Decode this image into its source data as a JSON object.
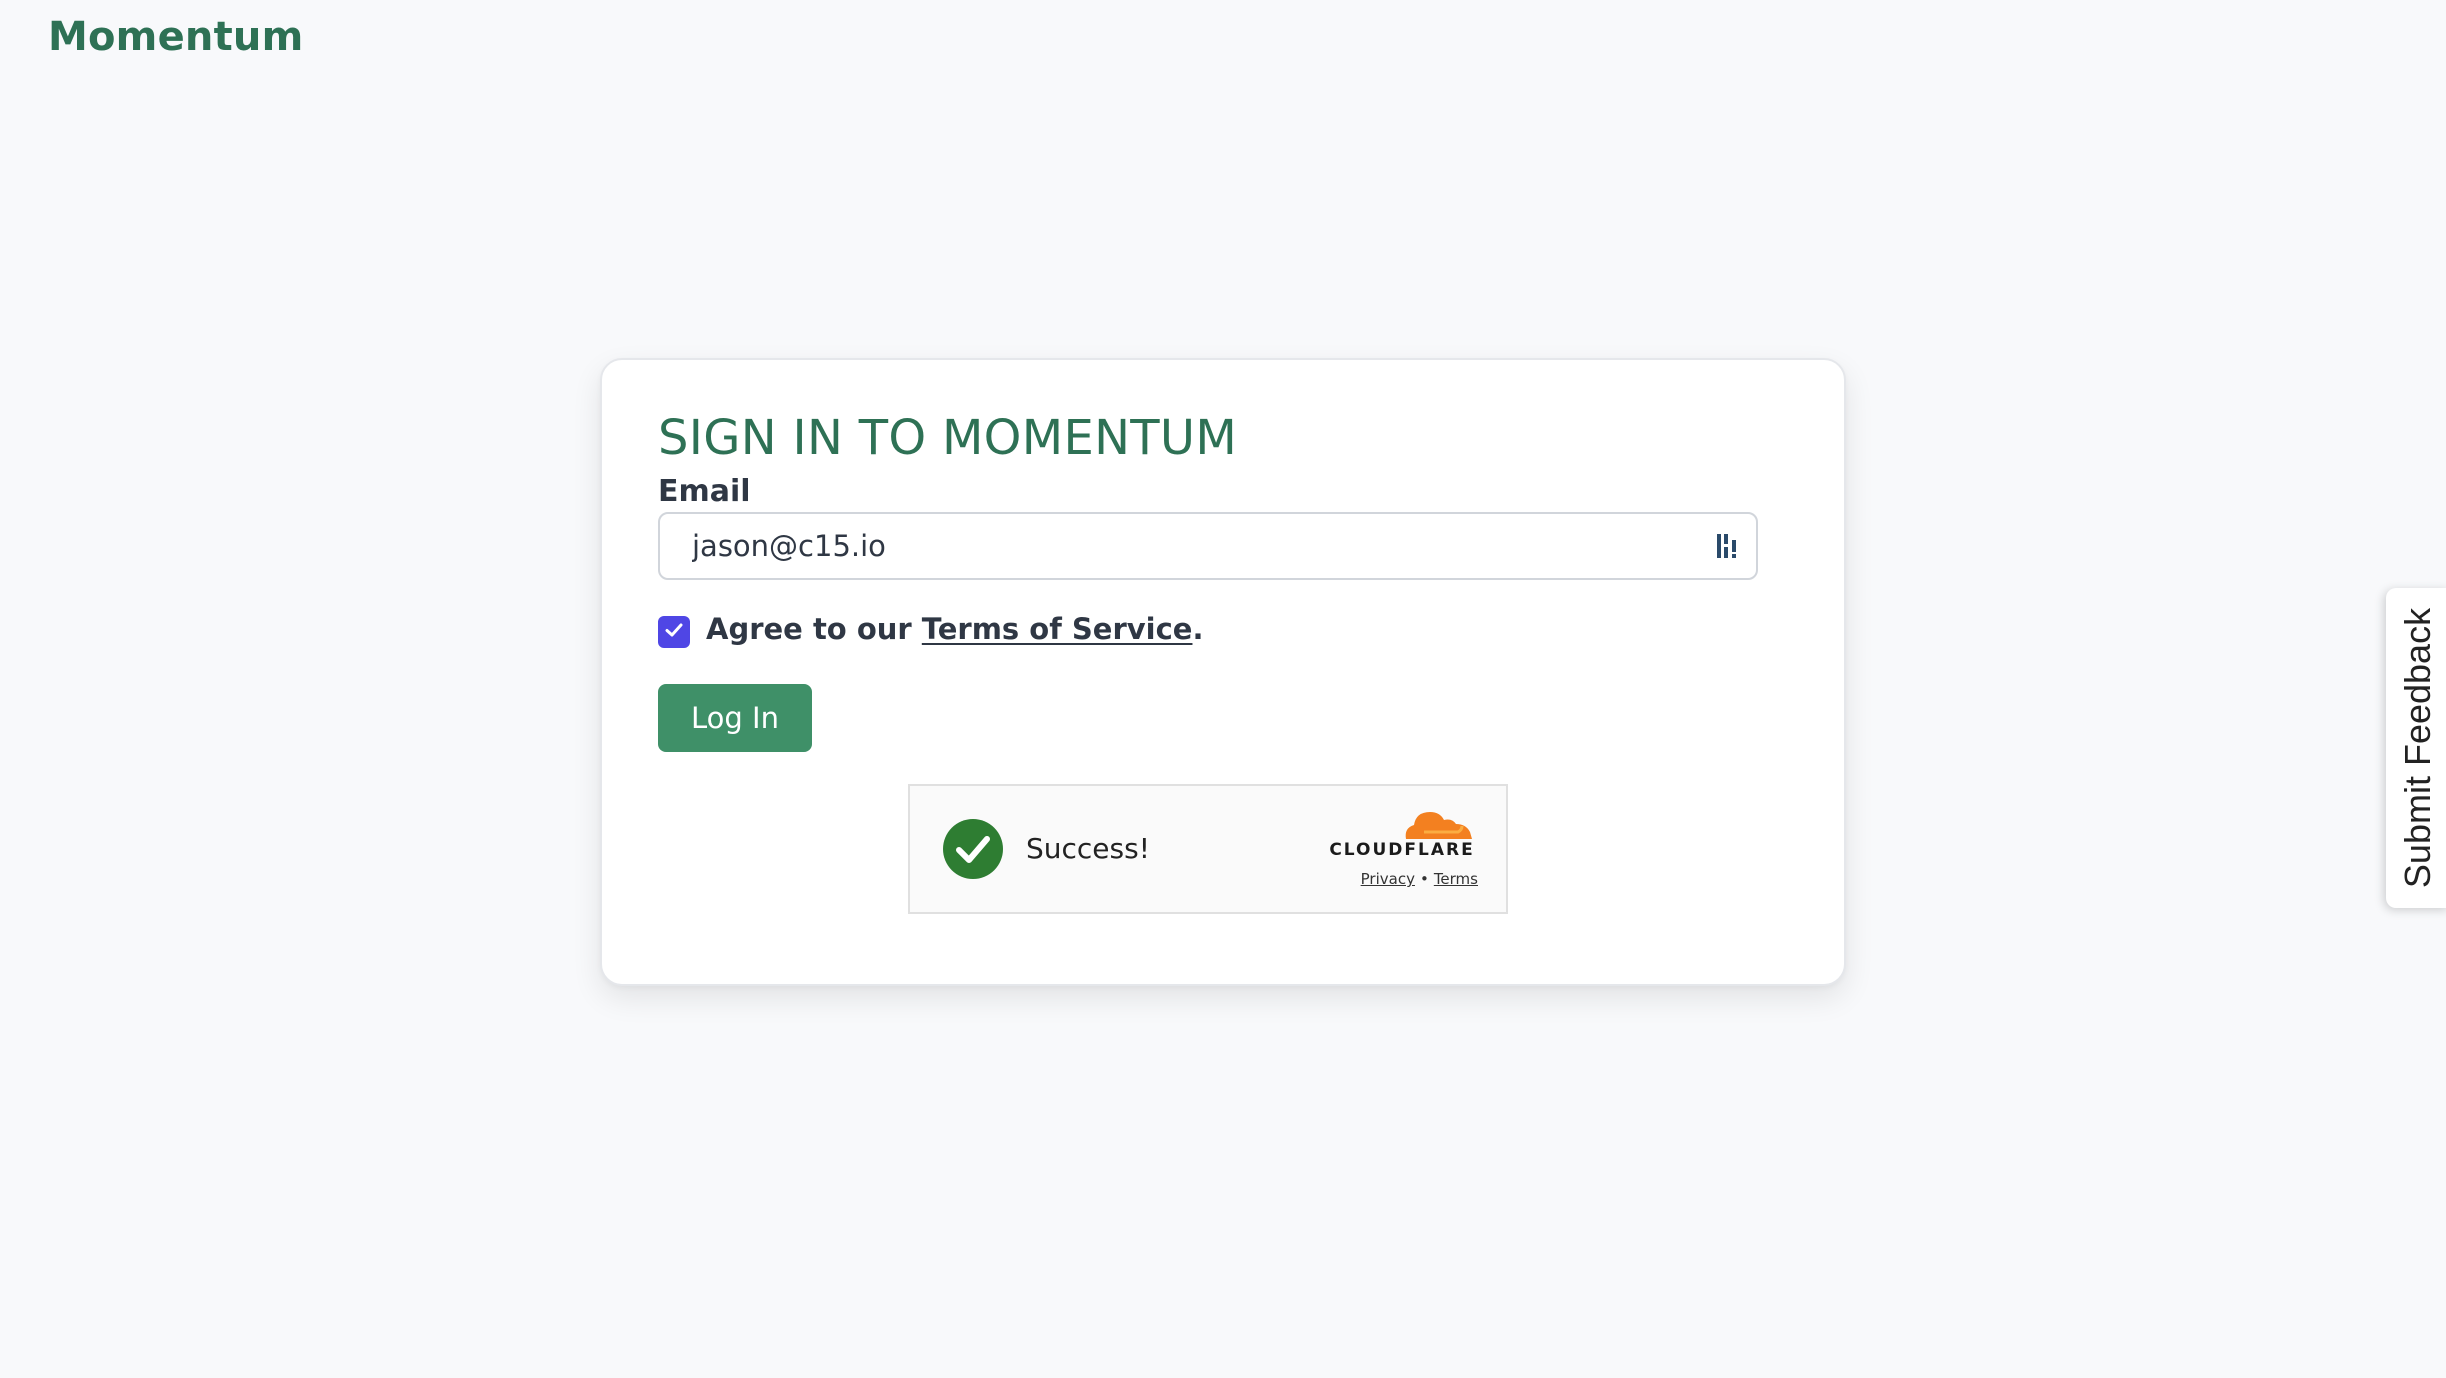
{
  "header": {
    "brand": "Momentum"
  },
  "login": {
    "title": "SIGN IN TO MOMENTUM",
    "email_label": "Email",
    "email_value": "jason@c15.io",
    "agree_prefix": "Agree to our ",
    "terms_link": "Terms of Service",
    "agree_suffix": ".",
    "agree_checked": true,
    "login_button": "Log In",
    "accent_color": "#2e7155",
    "button_color": "#3f9068",
    "checkbox_color": "#4f46e5"
  },
  "captcha": {
    "status": "Success!",
    "provider": "CLOUDFLARE",
    "privacy_link": "Privacy",
    "separator": "•",
    "terms_link": "Terms",
    "status_color": "#2e7d32",
    "provider_color": "#f38020"
  },
  "feedback": {
    "label": "Submit Feedback"
  },
  "icons": {
    "password_manager": "password-manager-icon",
    "checkbox": "check-icon",
    "captcha_success": "success-check-icon",
    "cloudflare": "cloudflare-cloud-icon"
  }
}
